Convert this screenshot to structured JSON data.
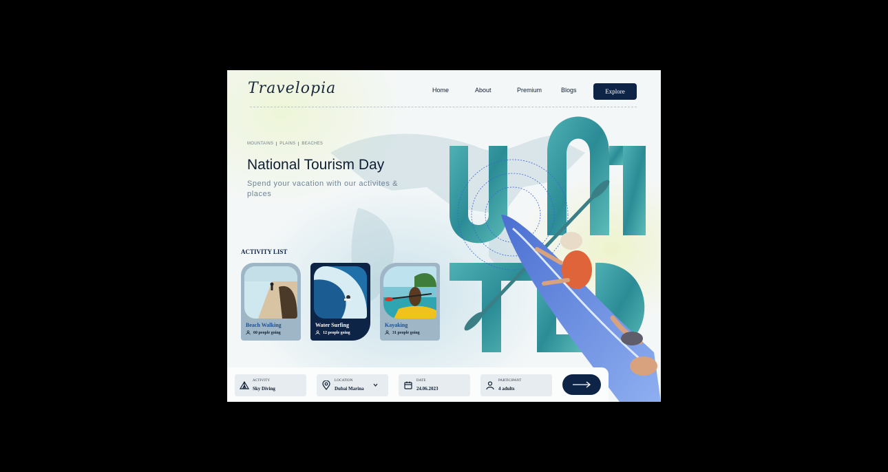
{
  "brand": {
    "logo": "Travelopia"
  },
  "nav": {
    "items": [
      "Home",
      "About",
      "Premium",
      "Blogs"
    ],
    "cta": "Explore"
  },
  "hero": {
    "tags": [
      "MOUNTAINS",
      "PLAINS",
      "BEACHES"
    ],
    "title": "National Tourism Day",
    "subtitle": "Spend your vacation with our activites & places"
  },
  "activities": {
    "heading": "ACTIVITY LIST",
    "items": [
      {
        "name": "Beach Walking",
        "going": "60 people going"
      },
      {
        "name": "Water Surfing",
        "going": "12 people going"
      },
      {
        "name": "Kayaking",
        "going": "31 people going"
      }
    ]
  },
  "search": {
    "activity": {
      "label": "ACTIVITY",
      "value": "Sky Diving",
      "icon": "tent-icon"
    },
    "location": {
      "label": "LOCATION",
      "value": "Dubai Marina",
      "icon": "map-pin-icon"
    },
    "date": {
      "label": "DATE",
      "value": "24.06.2023",
      "icon": "calendar-icon"
    },
    "participant": {
      "label": "PARTICIPANT",
      "value": "4 adults",
      "icon": "user-icon"
    },
    "submit_icon": "arrow-right-icon"
  },
  "colors": {
    "navy": "#0e2447",
    "water": "#2f8f9b",
    "card_light": "#9fb6c6"
  }
}
